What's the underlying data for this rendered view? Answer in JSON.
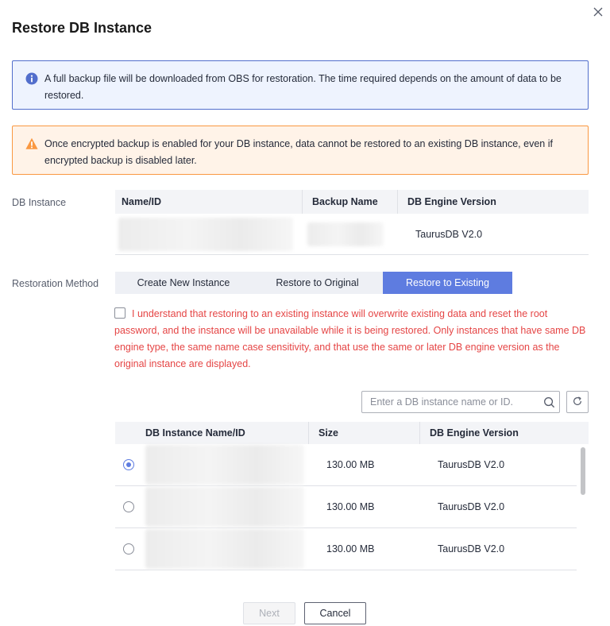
{
  "dialog": {
    "title": "Restore DB Instance"
  },
  "alerts": {
    "info": "A full backup file will be downloaded from OBS for restoration. The time required depends on the amount of data to be restored.",
    "warning": "Once encrypted backup is enabled for your DB instance, data cannot be restored to an existing DB instance, even if encrypted backup is disabled later."
  },
  "db_instance": {
    "label": "DB Instance",
    "columns": [
      "Name/ID",
      "Backup Name",
      "DB Engine Version"
    ],
    "row": {
      "engine_version": "TaurusDB V2.0"
    }
  },
  "restoration": {
    "label": "Restoration Method",
    "tabs": [
      "Create New Instance",
      "Restore to Original",
      "Restore to Existing"
    ],
    "selected_tab": "Restore to Existing",
    "agreement_text": "I understand that restoring to an existing instance will overwrite existing data and reset the root password, and the instance will be unavailable while it is being restored. Only instances that have same DB engine type, the same name case sensitivity, and that use the same or later DB engine version as the original instance are displayed."
  },
  "search": {
    "placeholder": "Enter a DB instance name or ID."
  },
  "target_table": {
    "columns": [
      "DB Instance Name/ID",
      "Size",
      "DB Engine Version"
    ],
    "rows": [
      {
        "size": "130.00 MB",
        "engine_version": "TaurusDB V2.0",
        "selected": true
      },
      {
        "size": "130.00 MB",
        "engine_version": "TaurusDB V2.0",
        "selected": false
      },
      {
        "size": "130.00 MB",
        "engine_version": "TaurusDB V2.0",
        "selected": false
      }
    ]
  },
  "footer": {
    "next_label": "Next",
    "cancel_label": "Cancel"
  },
  "colors": {
    "primary": "#5e7ce0",
    "info_border": "#526ecc",
    "warning": "#fa9841",
    "danger_text": "#e54545"
  }
}
